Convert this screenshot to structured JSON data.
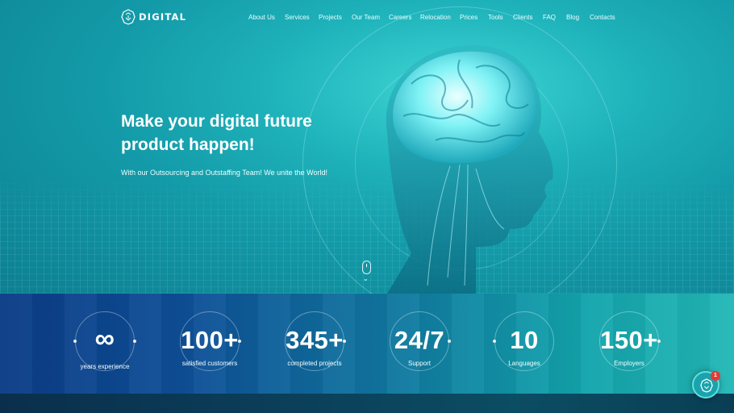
{
  "brand": {
    "name": "DIGITAL"
  },
  "nav": {
    "items": [
      "About Us",
      "Services",
      "Projects",
      "Our Team",
      "Careers",
      "Relocation",
      "Prices",
      "Tools",
      "Clients",
      "FAQ",
      "Blog",
      "Contacts"
    ]
  },
  "hero": {
    "headline_line1": "Make your digital future",
    "headline_line2": "product happen!",
    "subtitle": "With our Outsourcing and Outstaffing Team! We unite the World!"
  },
  "stats": [
    {
      "value": "∞",
      "label": "years experience"
    },
    {
      "value": "100+",
      "label": "satisfied customers"
    },
    {
      "value": "345+",
      "label": "completed projects"
    },
    {
      "value": "24/7",
      "label": "Support"
    },
    {
      "value": "10",
      "label": "Languages"
    },
    {
      "value": "150+",
      "label": "Employers"
    }
  ],
  "chat": {
    "badge_count": "1"
  },
  "colors": {
    "accent": "#1fb3bb",
    "stats_left": "#0b3c86",
    "stats_right": "#23b8b6",
    "badge": "#e53935"
  }
}
